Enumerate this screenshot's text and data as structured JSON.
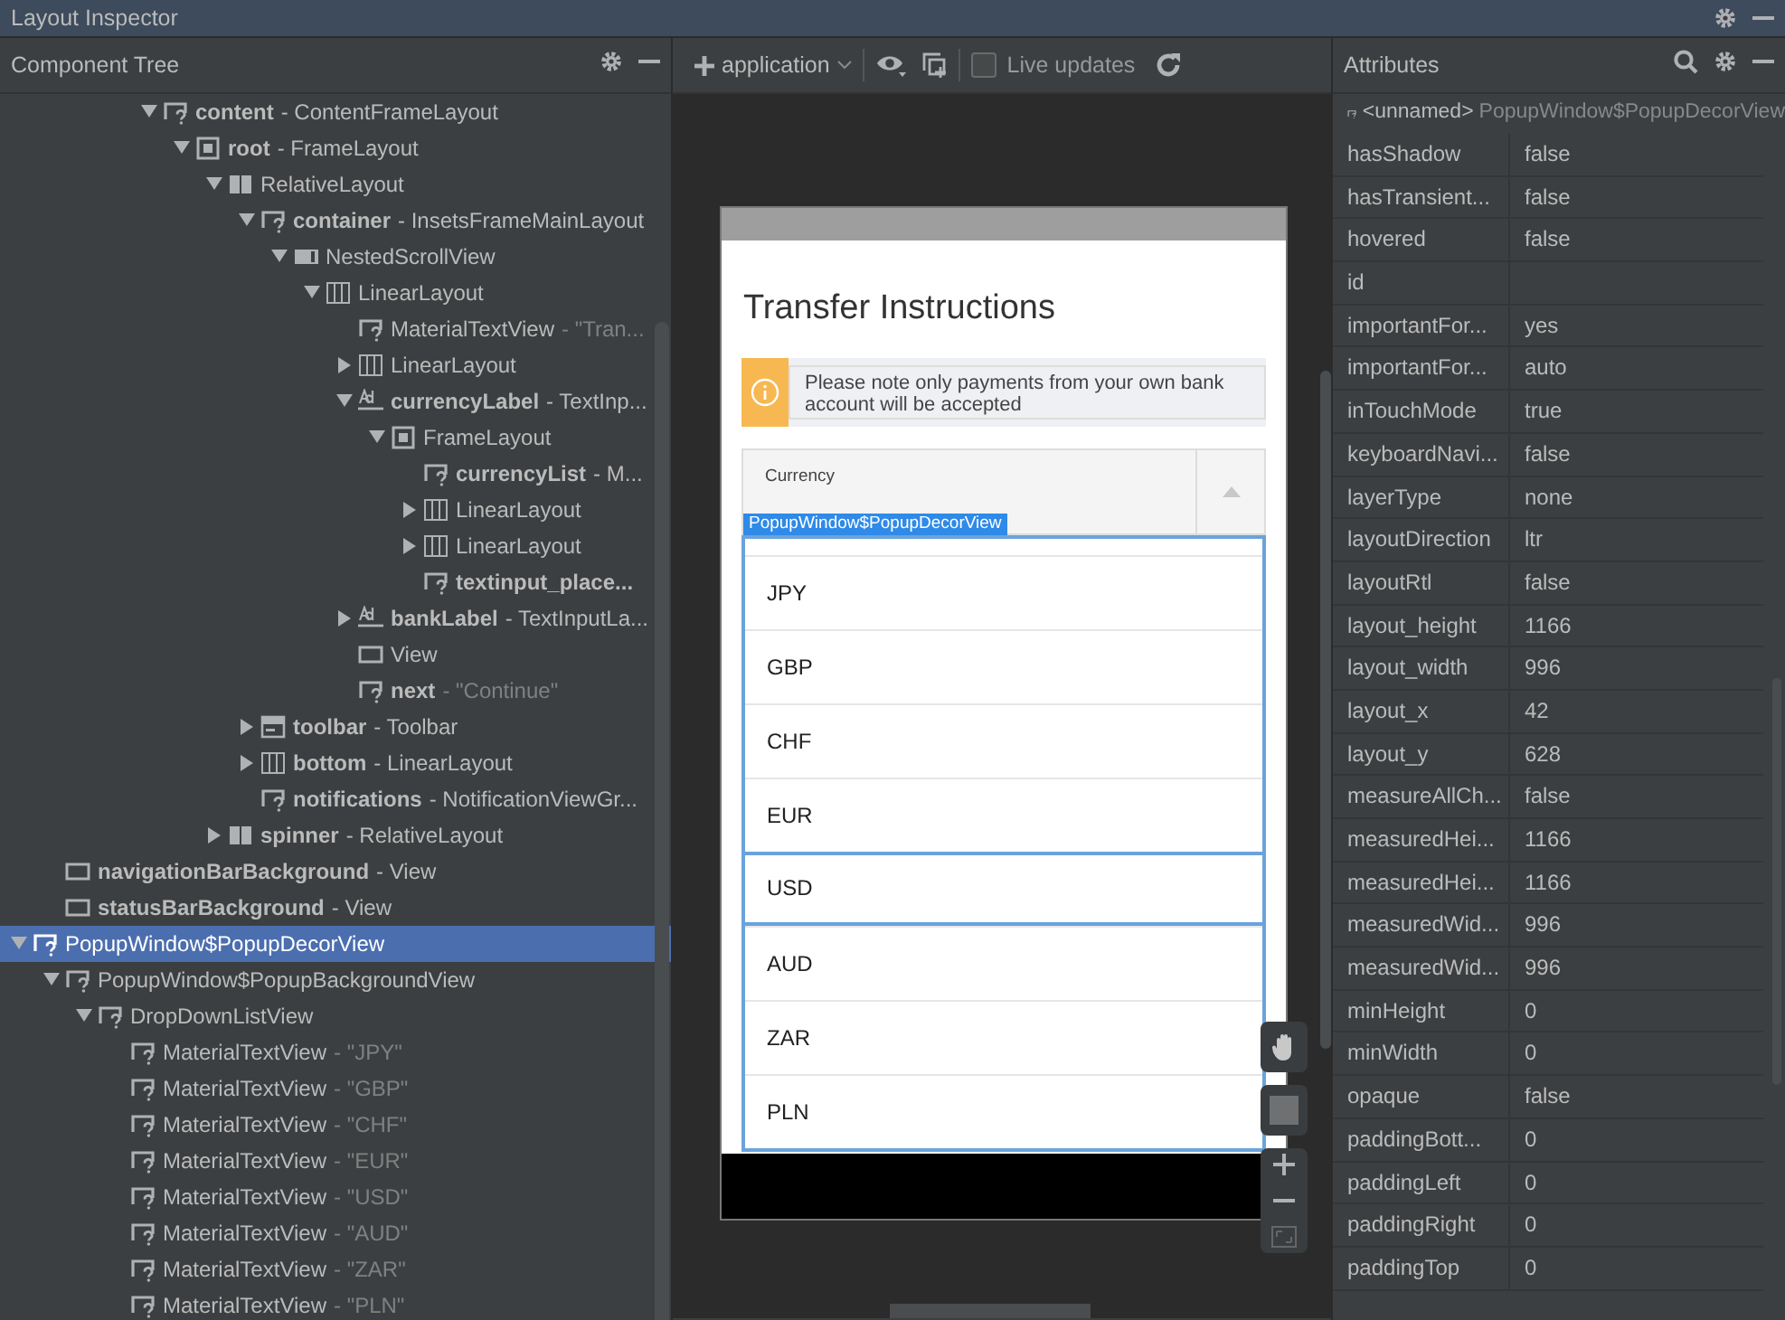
{
  "window": {
    "title": "Layout Inspector"
  },
  "component_tree": {
    "title": "Component Tree",
    "nodes": [
      {
        "children": [
          {
            "children": [
              {
                "children": [
                  {
                    "children": [
                      {
                        "id_name": "content",
                        "class_name": "- ContentFrameLayout",
                        "kind": "unknown",
                        "expanded": true,
                        "selected": false,
                        "children": [
                          {
                            "id_name": "root",
                            "class_name": "- FrameLayout",
                            "kind": "frame",
                            "expanded": true,
                            "selected": false,
                            "children": [
                              {
                                "class_name": "RelativeLayout",
                                "kind": "relative",
                                "expanded": true,
                                "selected": false,
                                "children": [
                                  {
                                    "id_name": "container",
                                    "class_name": "- InsetsFrameMainLayout",
                                    "kind": "unknown",
                                    "expanded": true,
                                    "selected": false,
                                    "children": [
                                      {
                                        "class_name": "NestedScrollView",
                                        "kind": "scroll",
                                        "expanded": true,
                                        "selected": false,
                                        "children": [
                                          {
                                            "class_name": "LinearLayout",
                                            "kind": "linear",
                                            "expanded": true,
                                            "selected": false,
                                            "children": [
                                              {
                                                "class_name": "MaterialTextView",
                                                "text_value": "- \"Tran...",
                                                "kind": "unknown",
                                                "selected": false
                                              },
                                              {
                                                "class_name": "LinearLayout",
                                                "kind": "linear",
                                                "expanded": false,
                                                "selected": false
                                              },
                                              {
                                                "id_name": "currencyLabel",
                                                "class_name": "- TextInp...",
                                                "kind": "text_input",
                                                "expanded": true,
                                                "selected": false,
                                                "children": [
                                                  {
                                                    "class_name": "FrameLayout",
                                                    "kind": "frame",
                                                    "expanded": true,
                                                    "selected": false,
                                                    "children": [
                                                      {
                                                        "id_name": "currencyList",
                                                        "class_name": "- M...",
                                                        "kind": "unknown",
                                                        "selected": false
                                                      },
                                                      {
                                                        "class_name": "LinearLayout",
                                                        "kind": "linear",
                                                        "expanded": false,
                                                        "selected": false
                                                      },
                                                      {
                                                        "class_name": "LinearLayout",
                                                        "kind": "linear",
                                                        "expanded": false,
                                                        "selected": false
                                                      },
                                                      {
                                                        "id_name": "textinput_place...",
                                                        "kind": "unknown",
                                                        "selected": false
                                                      }
                                                    ]
                                                  }
                                                ]
                                              },
                                              {
                                                "id_name": "bankLabel",
                                                "class_name": "- TextInputLa...",
                                                "kind": "text_input",
                                                "expanded": false,
                                                "selected": false
                                              },
                                              {
                                                "class_name": "View",
                                                "kind": "view",
                                                "selected": false
                                              },
                                              {
                                                "id_name": "next",
                                                "text_value": "- \"Continue\"",
                                                "kind": "unknown",
                                                "selected": false
                                              }
                                            ]
                                          }
                                        ]
                                      }
                                    ]
                                  },
                                  {
                                    "id_name": "toolbar",
                                    "class_name": "- Toolbar",
                                    "kind": "toolbar",
                                    "expanded": false,
                                    "selected": false
                                  },
                                  {
                                    "id_name": "bottom",
                                    "class_name": "- LinearLayout",
                                    "kind": "linear",
                                    "expanded": false,
                                    "selected": false
                                  },
                                  {
                                    "id_name": "notifications",
                                    "class_name": "- NotificationViewGr...",
                                    "kind": "unknown",
                                    "selected": false
                                  }
                                ]
                              },
                              {
                                "id_name": "spinner",
                                "class_name": "- RelativeLayout",
                                "kind": "relative",
                                "expanded": false,
                                "selected": false
                              }
                            ]
                          }
                        ]
                      }
                    ]
                  }
                ]
              }
            ]
          },
          {
            "id_name": "navigationBarBackground",
            "class_name": "- View",
            "kind": "view",
            "selected": false
          },
          {
            "id_name": "statusBarBackground",
            "class_name": "- View",
            "kind": "view",
            "selected": false
          }
        ]
      },
      {
        "class_name": "PopupWindow$PopupDecorView",
        "kind": "unknown",
        "expanded": true,
        "selected": true,
        "children": [
          {
            "class_name": "PopupWindow$PopupBackgroundView",
            "kind": "unknown",
            "expanded": true,
            "selected": false,
            "children": [
              {
                "class_name": "DropDownListView",
                "kind": "unknown",
                "expanded": true,
                "selected": false,
                "children": [
                  {
                    "class_name": "MaterialTextView",
                    "text_value": "- \"JPY\"",
                    "kind": "unknown",
                    "selected": false
                  },
                  {
                    "class_name": "MaterialTextView",
                    "text_value": "- \"GBP\"",
                    "kind": "unknown",
                    "selected": false
                  },
                  {
                    "class_name": "MaterialTextView",
                    "text_value": "- \"CHF\"",
                    "kind": "unknown",
                    "selected": false
                  },
                  {
                    "class_name": "MaterialTextView",
                    "text_value": "- \"EUR\"",
                    "kind": "unknown",
                    "selected": false
                  },
                  {
                    "class_name": "MaterialTextView",
                    "text_value": "- \"USD\"",
                    "kind": "unknown",
                    "selected": false
                  },
                  {
                    "class_name": "MaterialTextView",
                    "text_value": "- \"AUD\"",
                    "kind": "unknown",
                    "selected": false
                  },
                  {
                    "class_name": "MaterialTextView",
                    "text_value": "- \"ZAR\"",
                    "kind": "unknown",
                    "selected": false
                  },
                  {
                    "class_name": "MaterialTextView",
                    "text_value": "- \"PLN\"",
                    "kind": "unknown",
                    "selected": false
                  }
                ]
              }
            ]
          }
        ]
      }
    ]
  },
  "toolbar": {
    "process": "application",
    "live_updates": {
      "label": "Live updates",
      "checked": false
    }
  },
  "device_preview": {
    "title": "Transfer Instructions",
    "notice": "Please note only payments from your own bank account will be accepted",
    "field_label": "Currency",
    "overlay_label": "PopupWindow$PopupDecorView",
    "dropdown_items": [
      {
        "label": "JPY",
        "highlighted": false
      },
      {
        "label": "GBP",
        "highlighted": false
      },
      {
        "label": "CHF",
        "highlighted": false
      },
      {
        "label": "EUR",
        "highlighted": false
      },
      {
        "label": "USD",
        "highlighted": true
      },
      {
        "label": "AUD",
        "highlighted": false
      },
      {
        "label": "ZAR",
        "highlighted": false
      },
      {
        "label": "PLN",
        "highlighted": false
      }
    ]
  },
  "attributes": {
    "title": "Attributes",
    "node_name": "<unnamed>",
    "node_class": "PopupWindow$PopupDecorView",
    "rows": [
      {
        "name": "hasShadow",
        "value": "false"
      },
      {
        "name": "hasTransient...",
        "value": "false"
      },
      {
        "name": "hovered",
        "value": "false"
      },
      {
        "name": "id"
      },
      {
        "name": "importantFor...",
        "value": "yes"
      },
      {
        "name": "importantFor...",
        "value": "auto"
      },
      {
        "name": "inTouchMode",
        "value": "true"
      },
      {
        "name": "keyboardNavi...",
        "value": "false"
      },
      {
        "name": "layerType",
        "value": "none"
      },
      {
        "name": "layoutDirection",
        "value": "ltr"
      },
      {
        "name": "layoutRtl",
        "value": "false"
      },
      {
        "name": "layout_height",
        "value": "1166"
      },
      {
        "name": "layout_width",
        "value": "996"
      },
      {
        "name": "layout_x",
        "value": "42"
      },
      {
        "name": "layout_y",
        "value": "628"
      },
      {
        "name": "measureAllCh...",
        "value": "false"
      },
      {
        "name": "measuredHei...",
        "value": "1166"
      },
      {
        "name": "measuredHei...",
        "value": "1166"
      },
      {
        "name": "measuredWid...",
        "value": "996"
      },
      {
        "name": "measuredWid...",
        "value": "996"
      },
      {
        "name": "minHeight",
        "value": "0"
      },
      {
        "name": "minWidth",
        "value": "0"
      },
      {
        "name": "opaque",
        "value": "false"
      },
      {
        "name": "paddingBott...",
        "value": "0"
      },
      {
        "name": "paddingLeft",
        "value": "0"
      },
      {
        "name": "paddingRight",
        "value": "0"
      },
      {
        "name": "paddingTop",
        "value": "0"
      }
    ]
  }
}
